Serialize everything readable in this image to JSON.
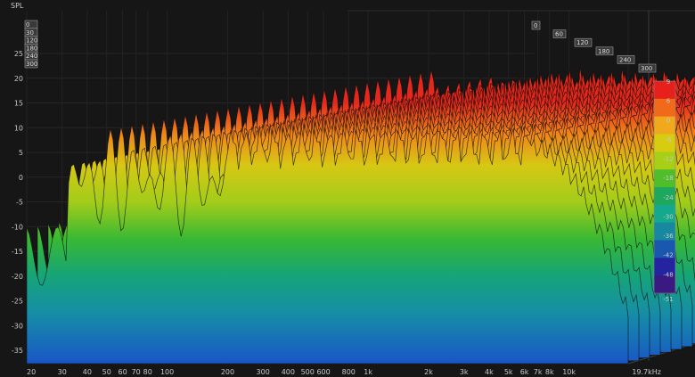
{
  "chart_data": {
    "type": "waterfall",
    "ylabel": "SPL",
    "xlabel_unit": "kHz",
    "spl_axis_ticks": [
      25,
      20,
      15,
      10,
      5,
      0,
      -5,
      -10,
      -15,
      -20,
      -25,
      -30,
      -35
    ],
    "freq_axis_ticks": [
      "20",
      "30",
      "40",
      "50",
      "60",
      "70",
      "80",
      "100",
      "200",
      "300",
      "400",
      "500",
      "600",
      "800",
      "1k",
      "2k",
      "3k",
      "4k",
      "5k",
      "6k",
      "7k",
      "8k",
      "10k",
      "19.7kHz"
    ],
    "freq_axis_values": [
      20,
      30,
      40,
      50,
      60,
      70,
      80,
      100,
      200,
      300,
      400,
      500,
      600,
      800,
      1000,
      2000,
      3000,
      4000,
      5000,
      6000,
      7000,
      8000,
      10000,
      19700
    ],
    "time_axis_ticks_back": [
      "0",
      "60",
      "120",
      "180",
      "240",
      "300"
    ],
    "time_axis_ticks_left": [
      "0",
      "30",
      "120",
      "180",
      "240",
      "300"
    ],
    "colorbar": {
      "ticks": [
        "9",
        "6",
        "0",
        "-6",
        "-12",
        "-18",
        "-24",
        "-30",
        "-36",
        "-42",
        "-48",
        "-51"
      ],
      "colors": [
        "#e8201c",
        "#f06a1a",
        "#f0a81c",
        "#d8cc10",
        "#a6cf16",
        "#50be2a",
        "#1ea85e",
        "#14a88c",
        "#1888a0",
        "#1a58b0",
        "#2424a0",
        "#3a1a80"
      ]
    },
    "surface": {
      "color_scale_min": -51,
      "color_scale_max": 9
    }
  }
}
